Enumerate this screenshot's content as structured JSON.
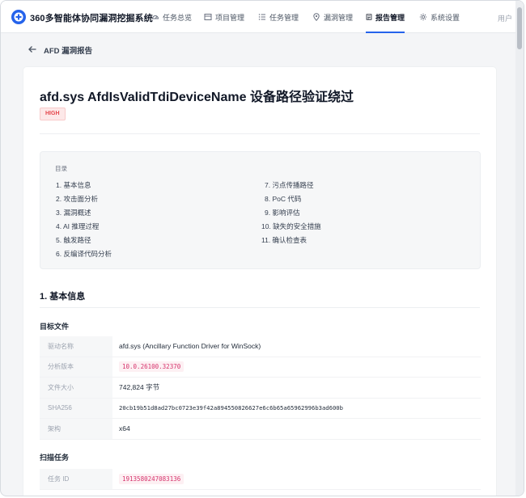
{
  "app": {
    "title": "360多智能体协同漏洞挖掘系统",
    "user": "用户"
  },
  "nav": {
    "items": [
      {
        "label": "任务总览",
        "icon": "dashboard-icon"
      },
      {
        "label": "项目管理",
        "icon": "project-icon"
      },
      {
        "label": "任务管理",
        "icon": "list-icon"
      },
      {
        "label": "漏洞管理",
        "icon": "location-pin-icon"
      },
      {
        "label": "报告管理",
        "icon": "report-icon",
        "active": true
      },
      {
        "label": "系统设置",
        "icon": "gear-icon"
      }
    ]
  },
  "page": {
    "title": "AFD 漏洞报告"
  },
  "report": {
    "title": "afd.sys AfdIsValidTdiDeviceName 设备路径验证绕过",
    "severity": "HIGH",
    "severity_color": "#e5484d",
    "toc": {
      "title": "目录",
      "left": [
        "1. 基本信息",
        "2. 攻击面分析",
        "3. 漏洞概述",
        "4. AI 推理过程",
        "5. 触发路径",
        "6. 反编译代码分析"
      ],
      "right": [
        "7. 污点传播路径",
        "8. PoC 代码",
        "9. 影响评估",
        "10. 缺失的安全措施",
        "11. 确认检查表"
      ]
    },
    "section1": {
      "title": "1. 基本信息",
      "target": {
        "title": "目标文件",
        "rows": [
          {
            "key": "驱动名称",
            "value": "afd.sys (Ancillary Function Driver for WinSock)"
          },
          {
            "key": "分析版本",
            "value": "10.0.26100.32370"
          },
          {
            "key": "文件大小",
            "value": "742,824 字节"
          },
          {
            "key": "SHA256",
            "value": "20cb19b51d8ad27bc0723e39f42a894550826627e6c6b65a65962996b3ad600b"
          },
          {
            "key": "架构",
            "value": "x64"
          }
        ]
      },
      "scan": {
        "title": "扫描任务",
        "rows": [
          {
            "key": "任务 ID",
            "value": "1913580247083136"
          }
        ]
      }
    }
  },
  "colors": {
    "accent": "#2563eb",
    "code_pill": "#d6336c"
  }
}
